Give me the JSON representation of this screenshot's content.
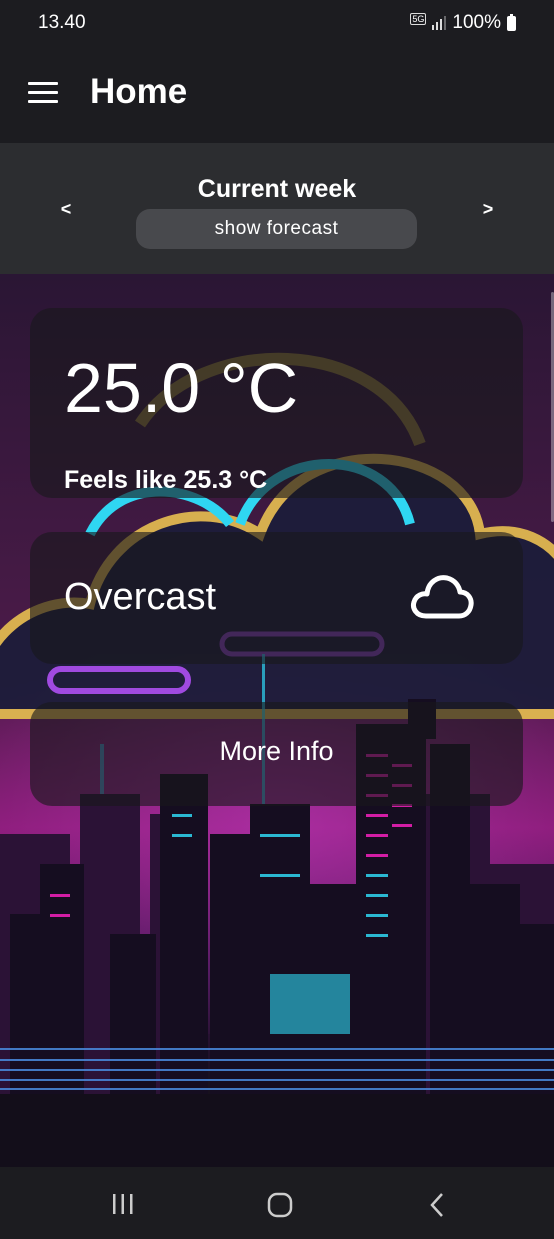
{
  "status_bar": {
    "time": "13.40",
    "network": "5G",
    "battery": "100%"
  },
  "app_bar": {
    "title": "Home"
  },
  "week_selector": {
    "prev": "<",
    "title": "Current week",
    "forecast_button": "show forecast",
    "next": ">"
  },
  "weather": {
    "temperature": "25.0 °C",
    "feels_like": "Feels like 25.3 °C",
    "condition": "Overcast",
    "condition_icon": "cloud-icon",
    "more_info": "More Info"
  },
  "colors": {
    "accent_pink": "#e81fb4",
    "accent_cyan": "#2fd6f2",
    "accent_purple": "#a04ae0",
    "accent_yellow": "#e0b850"
  }
}
